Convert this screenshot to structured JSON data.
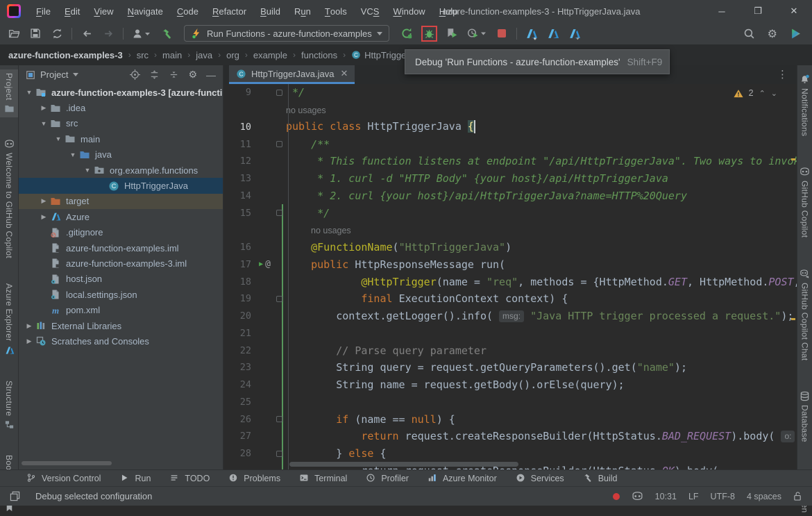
{
  "window": {
    "title": "azure-function-examples-3 - HttpTriggerJava.java",
    "menu": [
      {
        "label": "File",
        "accel": 0
      },
      {
        "label": "Edit",
        "accel": 0
      },
      {
        "label": "View",
        "accel": 0
      },
      {
        "label": "Navigate",
        "accel": 0
      },
      {
        "label": "Code",
        "accel": 0
      },
      {
        "label": "Refactor",
        "accel": 0
      },
      {
        "label": "Build",
        "accel": 0
      },
      {
        "label": "Run",
        "accel": 1
      },
      {
        "label": "Tools",
        "accel": 0
      },
      {
        "label": "VCS",
        "accel": 2
      },
      {
        "label": "Window",
        "accel": 0
      },
      {
        "label": "Help",
        "accel": 0
      }
    ],
    "controls": {
      "minimize": "─",
      "maximize": "❐",
      "close": "✕"
    }
  },
  "toolbar": {
    "run_config_label": "Run Functions - azure-function-examples",
    "tooltip": {
      "text": "Debug 'Run Functions - azure-function-examples'",
      "shortcut": "Shift+F9"
    }
  },
  "breadcrumbs": [
    {
      "label": "azure-function-examples-3",
      "bold": true
    },
    {
      "label": "src"
    },
    {
      "label": "main"
    },
    {
      "label": "java"
    },
    {
      "label": "org"
    },
    {
      "label": "example"
    },
    {
      "label": "functions"
    },
    {
      "label": "HttpTriggerJava",
      "icon": "class"
    }
  ],
  "left_stripe": [
    {
      "label": "Project",
      "icon": "folder",
      "iconpos": "bottom",
      "active": true
    },
    {
      "label": "Welcome to GitHub Copilot",
      "icon": "copilot",
      "iconpos": "top"
    },
    {
      "label": "Azure Explorer",
      "icon": "azure",
      "iconpos": "bottom"
    },
    {
      "label": "Structure",
      "icon": "structure",
      "iconpos": "bottom"
    },
    {
      "label": "Bookmarks",
      "icon": "bookmark",
      "iconpos": "bottom"
    }
  ],
  "right_stripe": [
    {
      "label": "Notifications",
      "icon": "bell"
    },
    {
      "label": "GitHub Copilot",
      "icon": "copilot"
    },
    {
      "label": "GitHub Copilot Chat",
      "icon": "copilot-chat"
    },
    {
      "label": "Database",
      "icon": "database"
    },
    {
      "label": "Maven",
      "icon": "maven"
    }
  ],
  "project_panel": {
    "title": "Project",
    "tree": [
      {
        "label": "azure-function-examples-3 [azure-functi",
        "icon": "project",
        "level": 0,
        "arrow": "open",
        "bold": true
      },
      {
        "label": ".idea",
        "icon": "folder",
        "level": 1,
        "arrow": "closed"
      },
      {
        "label": "src",
        "icon": "folder",
        "level": 1,
        "arrow": "open"
      },
      {
        "label": "main",
        "icon": "folder",
        "level": 2,
        "arrow": "open"
      },
      {
        "label": "java",
        "icon": "srcfolder",
        "level": 3,
        "arrow": "open"
      },
      {
        "label": "org.example.functions",
        "icon": "package",
        "level": 4,
        "arrow": "open"
      },
      {
        "label": "HttpTriggerJava",
        "icon": "class",
        "level": 5,
        "selected": true
      },
      {
        "label": "target",
        "icon": "excluded",
        "level": 1,
        "arrow": "closed",
        "hover": true
      },
      {
        "label": "Azure",
        "icon": "azure",
        "level": 1,
        "arrow": "closed"
      },
      {
        "label": ".gitignore",
        "icon": "gitignore",
        "level": 1
      },
      {
        "label": "azure-function-examples.iml",
        "icon": "iml",
        "level": 1
      },
      {
        "label": "azure-function-examples-3.iml",
        "icon": "iml",
        "level": 1
      },
      {
        "label": "host.json",
        "icon": "json",
        "level": 1
      },
      {
        "label": "local.settings.json",
        "icon": "json",
        "level": 1
      },
      {
        "label": "pom.xml",
        "icon": "maven",
        "level": 1
      },
      {
        "label": "External Libraries",
        "icon": "libraries",
        "level": 0,
        "arrow": "closed"
      },
      {
        "label": "Scratches and Consoles",
        "icon": "scratches",
        "level": 0,
        "arrow": "closed"
      }
    ]
  },
  "editor": {
    "tab_title": "HttpTriggerJava.java",
    "warning_count": "2",
    "rows": [
      {
        "num": "9",
        "fold": true,
        "seg": [
          {
            "t": " */",
            "c": "doc"
          }
        ]
      },
      {
        "inlay": "no usages",
        "pad": 0
      },
      {
        "num": "10",
        "cur": true,
        "seg": [
          {
            "t": "public class ",
            "c": "kw"
          },
          {
            "t": "HttpTriggerJava ",
            "c": "def"
          },
          {
            "t": "{",
            "c": "brace"
          }
        ]
      },
      {
        "num": "11",
        "fold": true,
        "seg": [
          {
            "t": "    ",
            "c": "def"
          },
          {
            "t": "/**",
            "c": "doc"
          }
        ]
      },
      {
        "num": "12",
        "seg": [
          {
            "t": "     * This function listens at endpoint \"/api/HttpTriggerJava\". Two ways to invoke it",
            "c": "doc"
          }
        ]
      },
      {
        "num": "13",
        "seg": [
          {
            "t": "     * 1. curl -d \"HTTP Body\" {your host}/api/HttpTriggerJava",
            "c": "doc"
          }
        ]
      },
      {
        "num": "14",
        "seg": [
          {
            "t": "     * 2. curl {your host}/api/HttpTriggerJava?name=HTTP%20Query",
            "c": "doc"
          }
        ]
      },
      {
        "num": "15",
        "fold": true,
        "seg": [
          {
            "t": "     */",
            "c": "doc"
          }
        ]
      },
      {
        "inlay": "no usages",
        "pad": 36
      },
      {
        "num": "16",
        "seg": [
          {
            "t": "    ",
            "c": "def"
          },
          {
            "t": "@FunctionName",
            "c": "ann"
          },
          {
            "t": "(",
            "c": "def"
          },
          {
            "t": "\"HttpTriggerJava\"",
            "c": "str"
          },
          {
            "t": ")",
            "c": "def"
          }
        ]
      },
      {
        "num": "17",
        "run": true,
        "seg": [
          {
            "t": "    ",
            "c": "def"
          },
          {
            "t": "public ",
            "c": "kw"
          },
          {
            "t": "HttpResponseMessage ",
            "c": "def"
          },
          {
            "t": "run(",
            "c": "def"
          }
        ]
      },
      {
        "num": "18",
        "seg": [
          {
            "t": "            ",
            "c": "def"
          },
          {
            "t": "@HttpTrigger",
            "c": "ann"
          },
          {
            "t": "(name = ",
            "c": "def"
          },
          {
            "t": "\"req\"",
            "c": "str"
          },
          {
            "t": ", methods = {HttpMethod.",
            "c": "def"
          },
          {
            "t": "GET",
            "c": "cst"
          },
          {
            "t": ", HttpMethod.",
            "c": "def"
          },
          {
            "t": "POST",
            "c": "cst"
          },
          {
            "t": ",",
            "c": "def"
          }
        ]
      },
      {
        "num": "19",
        "fold": true,
        "seg": [
          {
            "t": "            ",
            "c": "def"
          },
          {
            "t": "final ",
            "c": "kw"
          },
          {
            "t": "ExecutionContext context) {",
            "c": "def"
          }
        ]
      },
      {
        "num": "20",
        "seg": [
          {
            "t": "        context.getLogger().info( ",
            "c": "def"
          },
          {
            "t": "msg:",
            "c": "chip"
          },
          {
            "t": " ",
            "c": "def"
          },
          {
            "t": "\"Java HTTP trigger processed a request.\"",
            "c": "str"
          },
          {
            "t": ");",
            "c": "def"
          }
        ]
      },
      {
        "num": "21",
        "seg": []
      },
      {
        "num": "22",
        "seg": [
          {
            "t": "        ",
            "c": "def"
          },
          {
            "t": "// Parse query parameter",
            "c": "cmt"
          }
        ]
      },
      {
        "num": "23",
        "seg": [
          {
            "t": "        String query = request.getQueryParameters().get(",
            "c": "def"
          },
          {
            "t": "\"name\"",
            "c": "str"
          },
          {
            "t": ");",
            "c": "def"
          }
        ]
      },
      {
        "num": "24",
        "seg": [
          {
            "t": "        String name = request.getBody().orElse(query);",
            "c": "def"
          }
        ]
      },
      {
        "num": "25",
        "seg": []
      },
      {
        "num": "26",
        "fold": true,
        "seg": [
          {
            "t": "        ",
            "c": "def"
          },
          {
            "t": "if ",
            "c": "kw"
          },
          {
            "t": "(name == ",
            "c": "def"
          },
          {
            "t": "null",
            "c": "kw"
          },
          {
            "t": ") {",
            "c": "def"
          }
        ]
      },
      {
        "num": "27",
        "seg": [
          {
            "t": "            ",
            "c": "def"
          },
          {
            "t": "return ",
            "c": "kw"
          },
          {
            "t": "request.createResponseBuilder(HttpStatus.",
            "c": "def"
          },
          {
            "t": "BAD_REQUEST",
            "c": "cst"
          },
          {
            "t": ").body( ",
            "c": "def"
          },
          {
            "t": "o:",
            "c": "chip"
          }
        ]
      },
      {
        "num": "28",
        "fold": true,
        "seg": [
          {
            "t": "        } ",
            "c": "def"
          },
          {
            "t": "else ",
            "c": "kw"
          },
          {
            "t": "{",
            "c": "def"
          }
        ]
      },
      {
        "num": "",
        "seg": [
          {
            "t": "            return request.createResponseBuilder(HttpStatus.",
            "c": "def"
          },
          {
            "t": "OK",
            "c": "cst"
          },
          {
            "t": ").body(",
            "c": "def"
          }
        ]
      }
    ]
  },
  "bottom_buttons": [
    {
      "label": "Version Control",
      "icon": "branch"
    },
    {
      "label": "Run",
      "icon": "run"
    },
    {
      "label": "TODO",
      "icon": "todo"
    },
    {
      "label": "Problems",
      "icon": "problems"
    },
    {
      "label": "Terminal",
      "icon": "terminal"
    },
    {
      "label": "Profiler",
      "icon": "profiler"
    },
    {
      "label": "Azure Monitor",
      "icon": "azure-monitor"
    },
    {
      "label": "Services",
      "icon": "services"
    },
    {
      "label": "Build",
      "icon": "build"
    }
  ],
  "status_bar": {
    "message": "Debug selected configuration",
    "items": [
      "10:31",
      "LF",
      "UTF-8",
      "4 spaces"
    ]
  },
  "colors": {
    "accent_blue": "#4A88C7",
    "run_green": "#499C54",
    "stop_red": "#C75450",
    "warning_yellow": "#D9A343",
    "selection_blue": "#1D3D56",
    "debug_highlight_red": "#D64545"
  }
}
